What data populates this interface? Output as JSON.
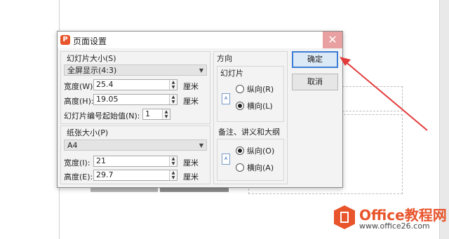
{
  "dialog": {
    "title": "页面设置",
    "close_glyph": "✕",
    "logo_letter": "P"
  },
  "slide_size": {
    "group_label": "幻灯片大小(S)",
    "preset_value": "全屏显示(4:3)",
    "width_label": "宽度(W):",
    "width_value": "25.4",
    "width_unit": "厘米",
    "height_label": "高度(H):",
    "height_value": "19.05",
    "height_unit": "厘米",
    "start_number_label": "幻灯片编号起始值(N):",
    "start_number_value": "1"
  },
  "paper_size": {
    "group_label": "纸张大小(P)",
    "preset_value": "A4",
    "width_label": "宽度(I):",
    "width_value": "21",
    "width_unit": "厘米",
    "height_label": "高度(E):",
    "height_value": "29.7",
    "height_unit": "厘米"
  },
  "orientation": {
    "group_label": "方向",
    "slides_label": "幻灯片",
    "slides_portrait": "纵向(R)",
    "slides_landscape": "横向(L)",
    "slides_selected": "landscape",
    "notes_label": "备注、讲义和大纲",
    "notes_portrait": "纵向(O)",
    "notes_landscape": "横向(A)",
    "notes_selected": "portrait"
  },
  "buttons": {
    "ok": "确定",
    "cancel": "取消"
  },
  "watermark": {
    "brand": "Office教程网",
    "url": "www.office26.com"
  },
  "colors": {
    "accent_blue": "#3c7ed6",
    "arrow_red": "#e23b3b",
    "brand_orange": "#e8542b"
  }
}
